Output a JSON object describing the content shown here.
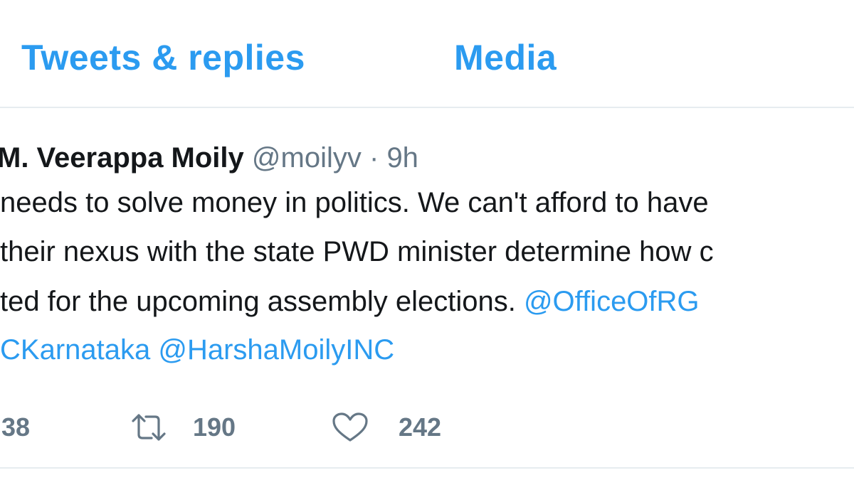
{
  "tabs": {
    "replies_label": "Tweets & replies",
    "media_label": "Media"
  },
  "tweet": {
    "author_name": "M. Veerappa Moily",
    "author_handle": "@moilyv",
    "separator": "·",
    "timestamp": "9h",
    "body_line_1": "needs to solve money in politics. We can't afford to have",
    "body_line_2": "their nexus with the state PWD minister determine how c",
    "body_line_3_text": "ted for the upcoming assembly elections.",
    "mention_office_of_rg": "@OfficeOfRG",
    "mention_inc_karnataka": "CKarnataka",
    "mention_harsha_moily": "@HarshaMoilyINC",
    "reply_count": "38",
    "retweet_count": "190",
    "like_count": "242"
  },
  "icons": {
    "retweet": "retweet-icon",
    "like": "heart-icon"
  },
  "colors": {
    "accent": "#2b9bf0",
    "text": "#14171a",
    "muted": "#657786",
    "divider": "#e6ecf0"
  }
}
